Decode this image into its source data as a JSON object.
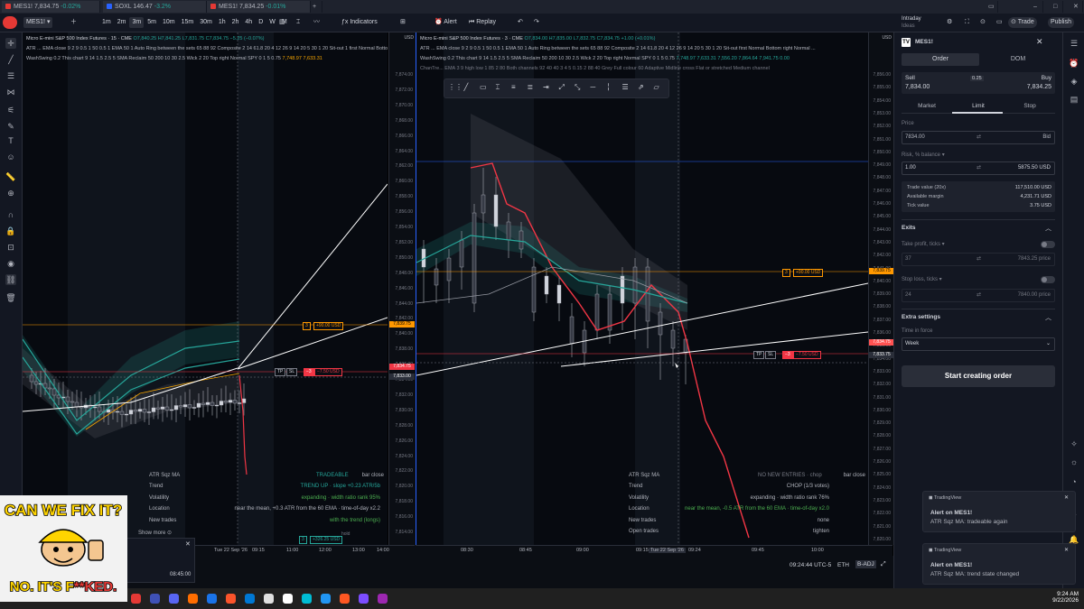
{
  "tabs": [
    {
      "label": "MES1!",
      "price": "7,834.75",
      "change": "-0.02%",
      "color": "#e53935"
    },
    {
      "label": "SOXL",
      "price": "146.47",
      "change": "-3.2%",
      "color": "#2962ff"
    },
    {
      "label": "MES1!",
      "price": "7,834.25",
      "change": "-0.01%",
      "color": "#e53935"
    }
  ],
  "toolbar": {
    "symbol": "MES1!",
    "intervals": [
      "1m",
      "2m",
      "3m",
      "5m",
      "10m",
      "15m",
      "30m",
      "1h",
      "2h",
      "4h",
      "D",
      "W",
      "M"
    ],
    "active_interval": "3m",
    "indicators": "Indicators",
    "alert": "Alert",
    "replay": "Replay",
    "intraday": "Intraday",
    "intraday_sub": "Ideas",
    "trade": "Trade",
    "publish": "Publish"
  },
  "left_chart": {
    "title": "Micro E-mini S&P 500 Index Futures · 15 · CME",
    "ohlc": "O7,840.25 H7,841.25 L7,831.75 C7,834.75 −5.25 (−0.07%)",
    "ind1": "ATR ... EMA close 9 2 9 0.5 1 50 0.5 1 EMA 50 1 Auto Ring between the sets 65 88 92 Composite 2 14 61.8 20 4 12 26 9 14 20 5 30 1 20 Sit-out 1 first Normal Bottom right Normal ...",
    "ind2": "WashSwing 0.2 This chart 9 14 1.5 2.5 5 SMA Reclaim 50 200 10 30 2.5 Wick 2 20 Top right Normal SPY 0 1 5 0.75",
    "ind2_vals": "7,748.97  7,633.31",
    "currency": "USD",
    "prices": [
      "7,874.00",
      "7,872.00",
      "7,870.00",
      "7,868.00",
      "7,866.00",
      "7,864.00",
      "7,862.00",
      "7,860.00",
      "7,858.00",
      "7,856.00",
      "7,854.00",
      "7,852.00",
      "7,850.00",
      "7,848.00",
      "7,846.00",
      "7,844.00",
      "7,842.00",
      "7,840.00",
      "7,838.00",
      "7,836.00",
      "7,834.00",
      "7,832.00",
      "7,830.00",
      "7,828.00",
      "7,826.00",
      "7,824.00",
      "7,822.00",
      "7,820.00",
      "7,818.00",
      "7,816.00",
      "7,814.00",
      "7,812.00"
    ],
    "price_tag": "7,839.75",
    "price_tag2": "7,834.75",
    "price_tag3": "7,833.00",
    "time_labels": [
      "Tue 22 Sep '26",
      "09:15",
      "11:00",
      "12:00",
      "13:00",
      "14:00"
    ],
    "tp_label": "+90.00 USD",
    "tp_qty": "3",
    "sl_label": "−7.50 USD",
    "sl_qty": "−3",
    "tp_chip": "TP",
    "sl_chip": "SL",
    "pos_label": "+326.25 USD",
    "pos_qty": "3",
    "hold": "hold",
    "show_more": "Show more",
    "panel": {
      "name": "ATR Sqz MA",
      "status": "TRADEABLE",
      "close": "bar close",
      "rows": [
        {
          "k": "Trend",
          "v": "TREND UP · slope +0.23 ATR/5b"
        },
        {
          "k": "Volatility",
          "v": "expanding · width ratio rank 95%"
        },
        {
          "k": "Location",
          "v": "near the mean, +0.3 ATR from the 60 EMA · time-of-day x2.2"
        },
        {
          "k": "New trades",
          "v": "with the trend (longs)"
        }
      ]
    }
  },
  "right_chart": {
    "title": "Micro E-mini S&P 500 Index Futures · 3 · CME",
    "ohlc": "O7,834.00 H7,835.00 L7,832.75 C7,834.75 +1.00 (+0.01%)",
    "ind1": "ATR ... EMA close 9 2 9 0.5 1 50 0.5 1 EMA 50 1 Auto Ring between the sets 65 88 92 Composite 2 14 61.8 20 4 12 26 9 14 20 5 30 1 20 Sit-out first Normal Bottom right Normal ...",
    "ind2": "WashSwing 0.2 This chart 9 14 1.5 2.5 5 SMA Reclaim 50 200 10 30 2.5 Wick 2 20 Top right Normal SPY 0 1 5 0.75",
    "ind2_vals": "7,748.97  7,633.31  7,556.20  7,864.64  7,941.75  0.00",
    "ind3": "ChanTre... EMA 3 9 high low 1 85 2 80 Both channels 92 40 40 3 4 5 0.15 2 88 40 Grey Full colour 60 Adaptive Midline cross Flat or stretched Medium channel",
    "currency": "USD",
    "prices": [
      "7,856.00",
      "7,855.00",
      "7,854.00",
      "7,853.00",
      "7,852.00",
      "7,851.00",
      "7,850.00",
      "7,849.00",
      "7,848.00",
      "7,847.00",
      "7,846.00",
      "7,845.00",
      "7,844.00",
      "7,843.00",
      "7,842.00",
      "7,841.00",
      "7,840.00",
      "7,839.00",
      "7,838.00",
      "7,837.00",
      "7,836.00",
      "7,835.00",
      "7,834.00",
      "7,833.00",
      "7,832.00",
      "7,831.00",
      "7,830.00",
      "7,829.00",
      "7,828.00",
      "7,827.00",
      "7,826.00",
      "7,825.00",
      "7,824.00",
      "7,823.00",
      "7,822.00",
      "7,821.00",
      "7,820.00"
    ],
    "price_tag": "7,839.75",
    "price_tag2": "7,834.75",
    "price_tag3": "7,833.75",
    "time_labels": [
      "08:30",
      "08:45",
      "09:00",
      "09:15",
      "Tue 22 Sep '26",
      "09:24",
      "09:45",
      "10:00"
    ],
    "tp_label": "+90.00 USD",
    "tp_qty": "3",
    "sl_label": "−7.50 USD",
    "sl_qty": "−3",
    "tp_chip": "TP",
    "sl_chip": "SL",
    "panel": {
      "name": "ATR Sqz MA",
      "status": "NO NEW ENTRIES · chop",
      "close": "bar close",
      "rows": [
        {
          "k": "Trend",
          "v": "CHOP (1/3 votes)"
        },
        {
          "k": "Volatility",
          "v": "expanding · width ratio rank 76%"
        },
        {
          "k": "Location",
          "v": "near the mean, -0.5 ATR from the 60 EMA · time-of-day x2.0"
        },
        {
          "k": "New trades",
          "v": "none"
        },
        {
          "k": "Open trades",
          "v": "tighten"
        }
      ]
    }
  },
  "bottom_bar": {
    "time": "09:24:44 UTC-5",
    "session": "ETH",
    "adj": "B-ADJ"
  },
  "order_panel": {
    "symbol": "MES1!",
    "tab_order": "Order",
    "tab_dom": "DOM",
    "sell": "Sell",
    "sell_price": "7,834.00",
    "spread": "0.25",
    "buy": "Buy",
    "buy_price": "7,834.25",
    "types": [
      "Market",
      "Limit",
      "Stop"
    ],
    "active_type": "Limit",
    "price_label": "Price",
    "price_value": "7834.00",
    "price_suffix": "Bid",
    "risk_label": "Risk, % balance",
    "risk_value": "1.00",
    "risk_suffix": "5875.50 USD",
    "trade_value_k": "Trade value (20x)",
    "trade_value_v": "117,510.00 USD",
    "margin_k": "Available margin",
    "margin_v": "4,231.71 USD",
    "tick_k": "Tick value",
    "tick_v": "3.75 USD",
    "exits": "Exits",
    "tp_label": "Take profit, ticks",
    "tp_value": "37",
    "tp_price": "7843.25 price",
    "sl_label": "Stop loss, ticks",
    "sl_value": "24",
    "sl_price": "7840.00 price",
    "extra": "Extra settings",
    "tif_label": "Time in force",
    "tif_value": "Week",
    "submit": "Start creating order"
  },
  "notifications": [
    {
      "app": "TradingView",
      "title": "Alert on MES1!",
      "body": "ATR Sqz MA: tradeable again"
    },
    {
      "app": "TradingView",
      "title": "Alert on MES1!",
      "body": "ATR Sqz MA: trend state changed"
    }
  ],
  "taskbar": {
    "time": "9:24 AM",
    "date": "9/22/2026"
  },
  "popup": {
    "time": "08:45:00"
  },
  "meme": {
    "top": "CAN WE FIX IT?",
    "bottom_a": "NO. IT'S F",
    "bottom_b": "**KED."
  }
}
